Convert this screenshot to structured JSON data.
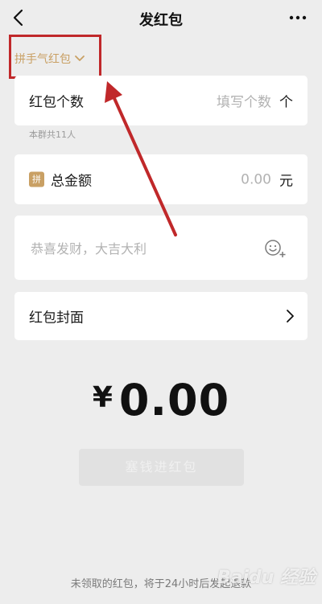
{
  "header": {
    "title": "发红包",
    "back_icon": "chevron-left-icon",
    "more_icon": "more-dots-icon"
  },
  "type_selector": {
    "label": "拼手气红包",
    "color": "#c9a064"
  },
  "count": {
    "label": "红包个数",
    "placeholder": "填写个数",
    "unit": "个",
    "hint": "本群共11人"
  },
  "amount": {
    "badge": "拼",
    "label": "总金额",
    "value": "0.00",
    "unit": "元"
  },
  "wish": {
    "placeholder": "恭喜发财，大吉大利",
    "emoji_icon": "emoji-add-icon"
  },
  "cover": {
    "label": "红包封面",
    "chevron_icon": "chevron-right-icon"
  },
  "total": {
    "currency": "¥",
    "amount": "0.00"
  },
  "submit": {
    "label": "塞钱进红包"
  },
  "footer": {
    "note": "未领取的红包，将于24小时后发起退款"
  },
  "annotation": {
    "color": "#c0282a"
  },
  "watermark": {
    "text": "Baidu 经验"
  }
}
